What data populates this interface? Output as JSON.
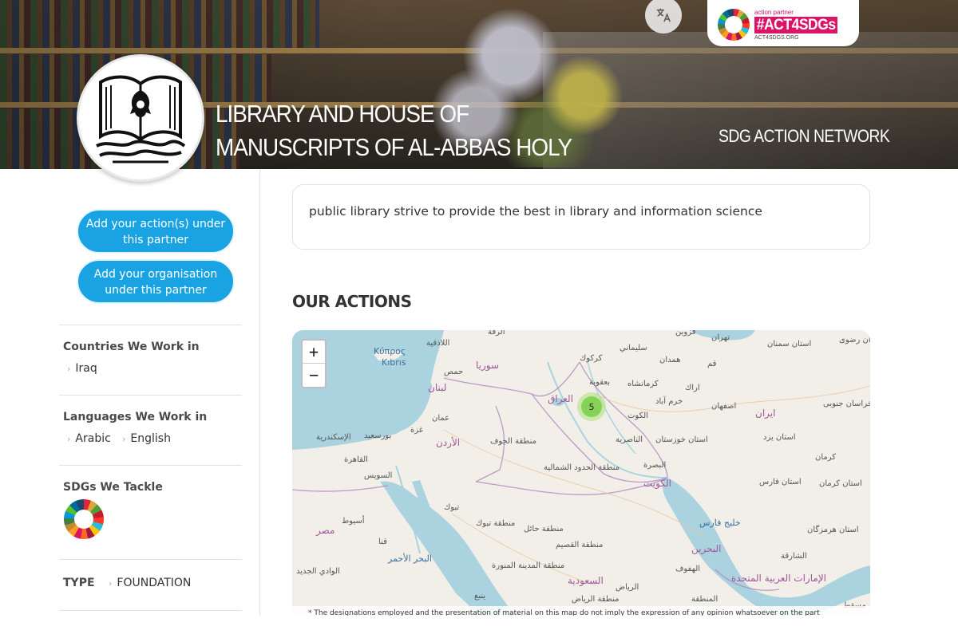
{
  "header": {
    "title": "LIBRARY AND HOUSE OF MANUSCRIPTS OF AL-ABBAS HOLY SHRINE",
    "network_label": "SDG ACTION NETWORK",
    "translate_icon": "translate-icon",
    "badge": {
      "small_text": "action partner",
      "big_text": "#ACT4SDGs",
      "url": "ACT4SDGS.ORG"
    }
  },
  "sidebar": {
    "add_action_label": "Add your action(s) under this partner",
    "add_org_label": "Add your organisation under this partner",
    "countries_heading": "Countries We Work in",
    "countries": [
      "Iraq"
    ],
    "languages_heading": "Languages We Work in",
    "languages": [
      "Arabic",
      "English"
    ],
    "sdgs_heading": "SDGs We Tackle",
    "type_label": "TYPE",
    "type_value": "FOUNDATION"
  },
  "main": {
    "description": "public library strive to provide the best in library and information science",
    "actions_heading": "OUR ACTIONS",
    "map": {
      "zoom_in": "+",
      "zoom_out": "−",
      "cluster_count": "5",
      "disclaimer": "* The designations employed and the presentation of material on this map do not imply the expression of any opinion whatsoever on the part",
      "labels": {
        "cyprus": "Κύπρος",
        "kibris": "Kıbrıs",
        "syria": "سوريا",
        "iraq": "العراق",
        "iran": "ایران",
        "jordan": "الأردن",
        "kuwait": "الكويت",
        "bahrain": "البحرين",
        "uae": "الإمارات العربية المتحدة",
        "saudi": "السعودية",
        "egypt": "مصر",
        "lebanon": "لبنان",
        "tehran": "تهران",
        "riyadh": "الرياض",
        "cairo": "القاهرة",
        "basra": "البصرة",
        "kirkuk": "كركوك",
        "isfahan": "اصفهان",
        "tabuk": "تبوك",
        "amman": "عمان",
        "alexandria": "الإسكندرية",
        "suez": "السويس",
        "hofuf": "الهفوف",
        "sharjah": "الشارقة",
        "homs": "حمص",
        "latakia": "اللاذقية",
        "raqqa": "الرقة",
        "qazvin": "قزوين",
        "kermanshah": "كرمانشاه",
        "hamadan": "همدان",
        "qom": "قم",
        "kerman": "كرمان",
        "gaza": "غزة",
        "port_said": "بورسعيد",
        "assiut": "أسيوط",
        "qena": "قنا",
        "red_sea": "البحر الأحمر",
        "baquba": "بعقوبة",
        "kut": "الكوت",
        "nasiriyah": "الناصرية",
        "sulaymaniyah": "سليماني",
        "arak": "اراك",
        "khorramabad": "خرم آباد",
        "yanbu": "ينبع",
        "new_valley": "الوادي الجديد",
        "khuzestan": "استان خوزستان",
        "fars": "استان فارس",
        "yazd": "استان یزد",
        "semnan": "استان سمنان",
        "kerman_province": "استان کرمان",
        "hormozgan": "استان هرمزگان",
        "south_khorasan": "استان خراسان جنوبی",
        "razavi_khorasan": "استان خراسان رضوی",
        "northern_borders": "منطقة الحدود الشمالية",
        "jawf": "منطقة الجوف",
        "tabuk_region": "منطقة تبوك",
        "hail": "منطقة حائل",
        "qassim": "منطقة القصيم",
        "madinah": "منطقة المدينة المنورة",
        "riyadh_region": "منطقة الرياض",
        "eastern_region": "المنطقة",
        "persian_gulf": "خليج فارس",
        "muscat": "مسقط"
      }
    }
  },
  "colors": {
    "accent": "#1aa3e3",
    "badge_pink": "#dd1367",
    "map_water": "#aad3df",
    "map_land": "#f2efe9"
  }
}
